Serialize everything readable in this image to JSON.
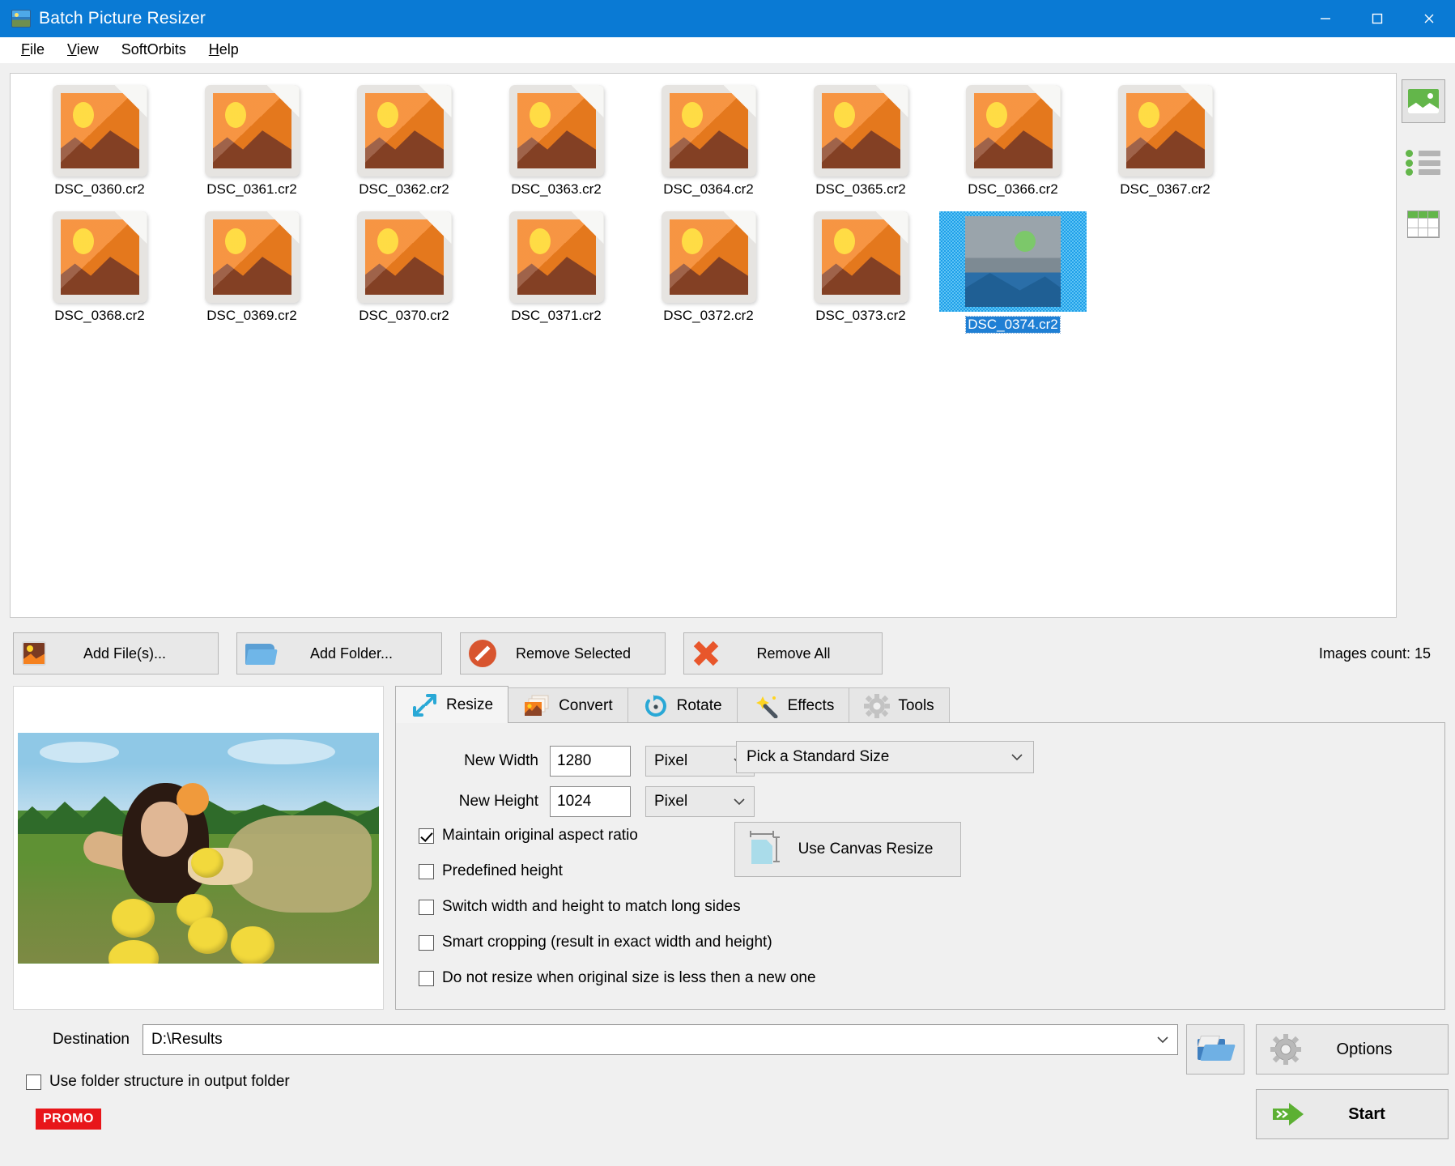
{
  "window": {
    "title": "Batch Picture Resizer",
    "app_icon": "app-photo-icon",
    "minimize": "minimize-icon",
    "maximize": "maximize-icon",
    "close": "close-icon",
    "titlebar_color": "#0a7ad4"
  },
  "menu": {
    "items": [
      {
        "label": "File",
        "mnemonic": "F"
      },
      {
        "label": "View",
        "mnemonic": "V"
      },
      {
        "label": "SoftOrbits",
        "mnemonic": ""
      },
      {
        "label": "Help",
        "mnemonic": "H"
      }
    ]
  },
  "thumbnails": {
    "items": [
      {
        "name": "DSC_0360.cr2",
        "selected": false
      },
      {
        "name": "DSC_0361.cr2",
        "selected": false
      },
      {
        "name": "DSC_0362.cr2",
        "selected": false
      },
      {
        "name": "DSC_0363.cr2",
        "selected": false
      },
      {
        "name": "DSC_0364.cr2",
        "selected": false
      },
      {
        "name": "DSC_0365.cr2",
        "selected": false
      },
      {
        "name": "DSC_0366.cr2",
        "selected": false
      },
      {
        "name": "DSC_0367.cr2",
        "selected": false
      },
      {
        "name": "DSC_0368.cr2",
        "selected": false
      },
      {
        "name": "DSC_0369.cr2",
        "selected": false
      },
      {
        "name": "DSC_0370.cr2",
        "selected": false
      },
      {
        "name": "DSC_0371.cr2",
        "selected": false
      },
      {
        "name": "DSC_0372.cr2",
        "selected": false
      },
      {
        "name": "DSC_0373.cr2",
        "selected": false
      },
      {
        "name": "DSC_0374.cr2",
        "selected": true
      }
    ]
  },
  "view_modes": [
    {
      "icon": "thumbnail-view-icon",
      "active": true
    },
    {
      "icon": "list-view-icon",
      "active": false
    },
    {
      "icon": "grid-view-icon",
      "active": false
    }
  ],
  "actions": {
    "add_files": "Add File(s)...",
    "add_folder": "Add Folder...",
    "remove_selected": "Remove Selected",
    "remove_all": "Remove All",
    "images_count": "Images count: 15"
  },
  "tabs": [
    {
      "label": "Resize",
      "icon": "resize-arrows-icon",
      "active": true
    },
    {
      "label": "Convert",
      "icon": "convert-images-icon",
      "active": false
    },
    {
      "label": "Rotate",
      "icon": "rotate-icon",
      "active": false
    },
    {
      "label": "Effects",
      "icon": "magic-wand-icon",
      "active": false
    },
    {
      "label": "Tools",
      "icon": "gear-tools-icon",
      "active": false
    }
  ],
  "resize": {
    "new_width_label": "New Width",
    "new_width_value": "1280",
    "new_width_unit": "Pixel",
    "new_height_label": "New Height",
    "new_height_value": "1024",
    "new_height_unit": "Pixel",
    "standard_size": "Pick a Standard Size",
    "canvas_resize": "Use Canvas Resize",
    "checkboxes": [
      {
        "label": "Maintain original aspect ratio",
        "checked": true
      },
      {
        "label": "Predefined height",
        "checked": false
      },
      {
        "label": "Switch width and height to match long sides",
        "checked": false
      },
      {
        "label": "Smart cropping (result in exact width and height)",
        "checked": false
      },
      {
        "label": "Do not resize when original size is less then a new one",
        "checked": false
      }
    ]
  },
  "preview": {
    "alt": "woman lying in grass field with yellow fruits"
  },
  "bottom": {
    "destination_label": "Destination",
    "destination_value": "D:\\Results",
    "folder_structure_label": "Use folder structure in output folder",
    "folder_structure_checked": false,
    "promo": "PROMO",
    "browse_icon": "open-folder-icon",
    "options": "Options",
    "start": "Start"
  },
  "colors": {
    "accent": "#0a7ad4",
    "promo_red": "#e8161a",
    "start_green": "#5cb033",
    "selection_blue": "#1f7fd4"
  }
}
